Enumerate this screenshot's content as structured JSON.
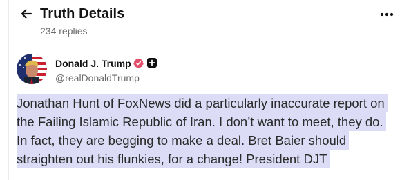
{
  "header": {
    "title": "Truth Details",
    "reply_count": "234 replies",
    "back_icon": "arrow-left-icon",
    "more_icon": "more-horizontal-icon"
  },
  "post": {
    "author": {
      "name": "Donald J. Trump",
      "handle": "@realDonaldTrump",
      "verified_icon": "verified-badge-icon",
      "verified_color": "#e34f6a",
      "extra_icon": "plus-badge-icon"
    },
    "text_lines": [
      "Jonathan Hunt of FoxNews did a particularly inaccurate report on",
      "the Failing Islamic Republic of Iran. I don’t want to meet, they do.",
      "In fact, they are begging to make a deal. Bret Baier should",
      "straighten out his flunkies, for a change! President DJT"
    ],
    "highlight_color": "#dcdcf6"
  }
}
